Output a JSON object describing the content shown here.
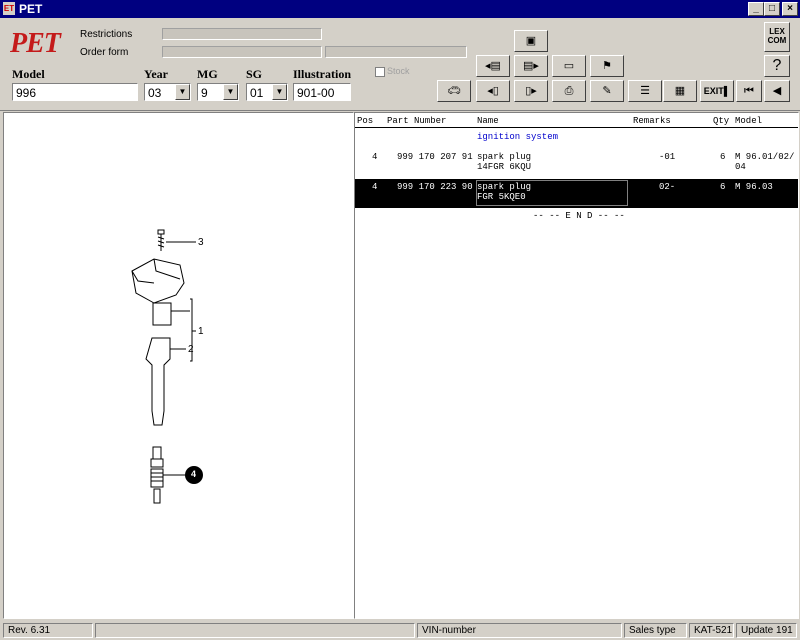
{
  "window": {
    "title": "PET",
    "min": "_",
    "max": "□",
    "close": "×"
  },
  "logo": "PET",
  "restrictions_label": "Restrictions",
  "order_form_label": "Order form",
  "stock_label": "Stock",
  "selectors": {
    "model": {
      "label": "Model",
      "value": "996"
    },
    "year": {
      "label": "Year",
      "value": "03"
    },
    "mg": {
      "label": "MG",
      "value": "9"
    },
    "sg": {
      "label": "SG",
      "value": "01"
    },
    "illustration": {
      "label": "Illustration",
      "value": "901-00"
    }
  },
  "toolbar_buttons": {
    "exit": "EXIT",
    "lexcom": "LEX\nCOM",
    "help": "?"
  },
  "table": {
    "headers": {
      "pos": "Pos",
      "part_number": "Part Number",
      "name": "Name",
      "remarks": "Remarks",
      "qty": "Qty",
      "model": "Model"
    },
    "section_title": "ignition system",
    "rows": [
      {
        "pos": "4",
        "part_number": "999 170 207 91",
        "name1": "spark plug",
        "name2": "14FGR 6KQU",
        "remarks": "-01",
        "qty": "6",
        "model1": "M 96.01/02/",
        "model2": "04"
      },
      {
        "pos": "4",
        "part_number": "999 170 223 90",
        "name1": "spark plug",
        "name2": "FGR 5KQE0",
        "remarks": "02-",
        "qty": "6",
        "model1": "M 96.03",
        "model2": ""
      }
    ],
    "end_marker": "-- -- E N D -- --"
  },
  "illustration_labels": {
    "item3": "3",
    "item1": "1",
    "item2": "2",
    "item4": "4"
  },
  "status": {
    "rev": "Rev. 6.31",
    "vin": "VIN-number",
    "sales_type": "Sales type",
    "kat": "KAT-521",
    "update": "Update 191"
  },
  "colors": {
    "titlebar": "#000080",
    "logo": "#c41a1a",
    "section_title": "#0000cc",
    "selection": "#000000"
  }
}
